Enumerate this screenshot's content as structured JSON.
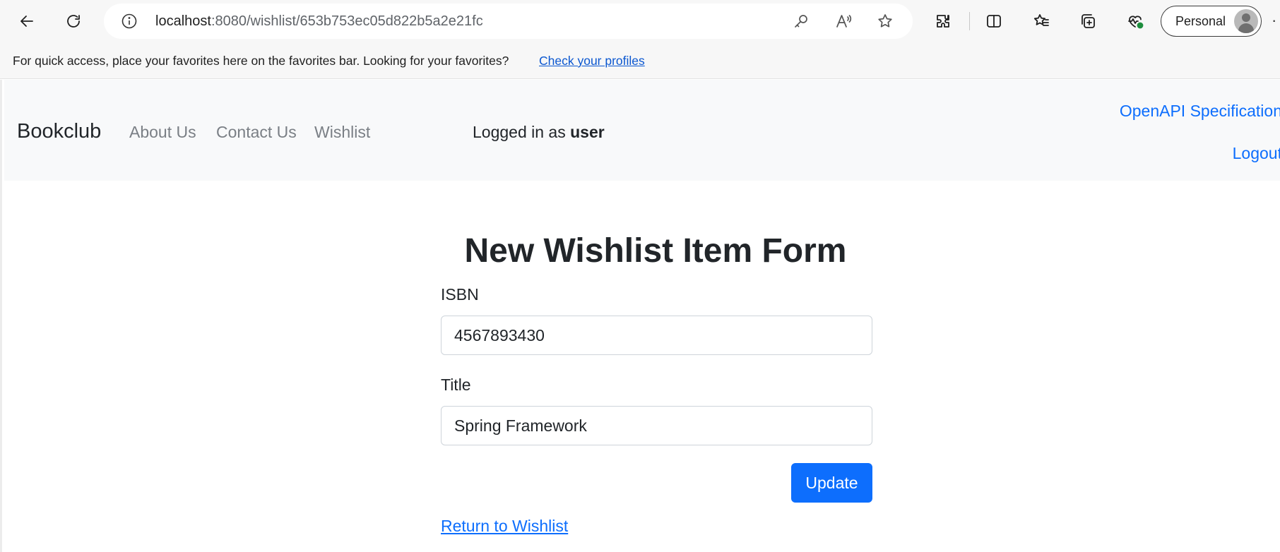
{
  "browser": {
    "url_host": "localhost",
    "url_path": ":8080/wishlist/653b753ec05d822b5a2e21fc",
    "profile_label": "Personal",
    "favorites_message": "For quick access, place your favorites here on the favorites bar. Looking for your favorites?",
    "favorites_link": "Check your profiles",
    "icons": [
      "back-arrow-icon",
      "refresh-icon",
      "info-icon",
      "key-icon",
      "read-aloud-icon",
      "favorite-star-icon",
      "extensions-icon",
      "split-screen-icon",
      "favorites-icon",
      "collections-icon",
      "browser-essentials-icon",
      "avatar-icon"
    ]
  },
  "navbar": {
    "brand": "Bookclub",
    "links": [
      "About Us",
      "Contact Us",
      "Wishlist"
    ],
    "logged_in_prefix": "Logged in as ",
    "username": "user",
    "openapi_link": "OpenAPI Specification",
    "logout_link": "Logout"
  },
  "form": {
    "title": "New Wishlist Item Form",
    "isbn_label": "ISBN",
    "isbn_value": "4567893430",
    "title_label": "Title",
    "title_value": "Spring Framework",
    "submit_label": "Update",
    "return_link": "Return to Wishlist"
  },
  "colors": {
    "primary": "#0d6efd",
    "navbar_bg": "#f8f9fa",
    "nav_link": "#7a7f85",
    "text": "#212529"
  }
}
